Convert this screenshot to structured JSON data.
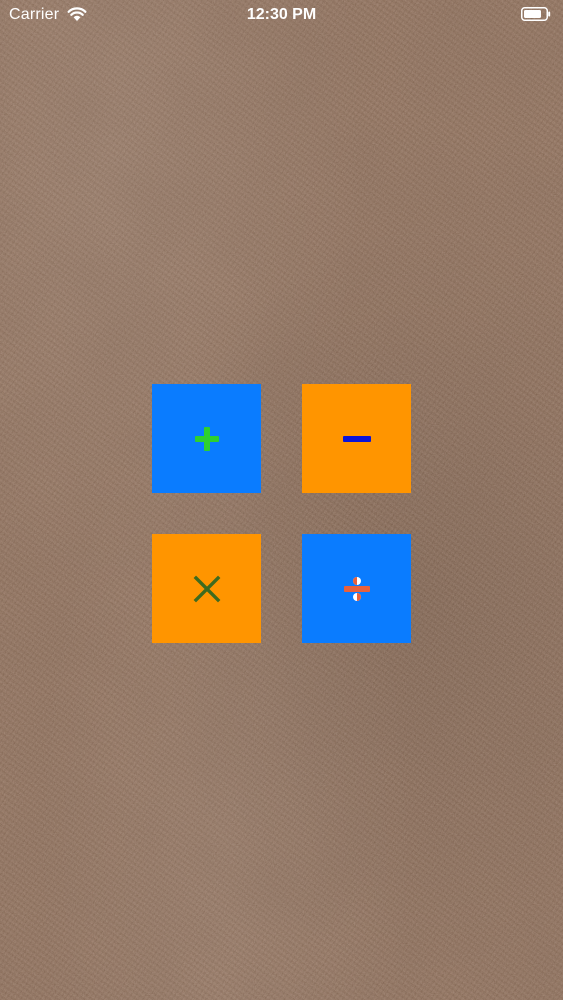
{
  "status_bar": {
    "carrier": "Carrier",
    "time": "12:30 PM",
    "wifi_icon": "wifi-icon",
    "battery_icon": "battery-icon",
    "text_color": "#ffffff"
  },
  "background": {
    "style": "brown leather texture",
    "color": "#8a6a55"
  },
  "operations": [
    {
      "name": "add",
      "icon": "plus-icon",
      "button_color": "#0a7cff",
      "symbol_color": "#2ed02e"
    },
    {
      "name": "subtract",
      "icon": "minus-icon",
      "button_color": "#ff9500",
      "symbol_color": "#0a14d8"
    },
    {
      "name": "multiply",
      "icon": "multiply-icon",
      "button_color": "#ff9500",
      "symbol_color": "#3e6b1f"
    },
    {
      "name": "divide",
      "icon": "divide-icon",
      "button_color": "#0a7cff",
      "symbol_color": "#e8613c"
    }
  ]
}
